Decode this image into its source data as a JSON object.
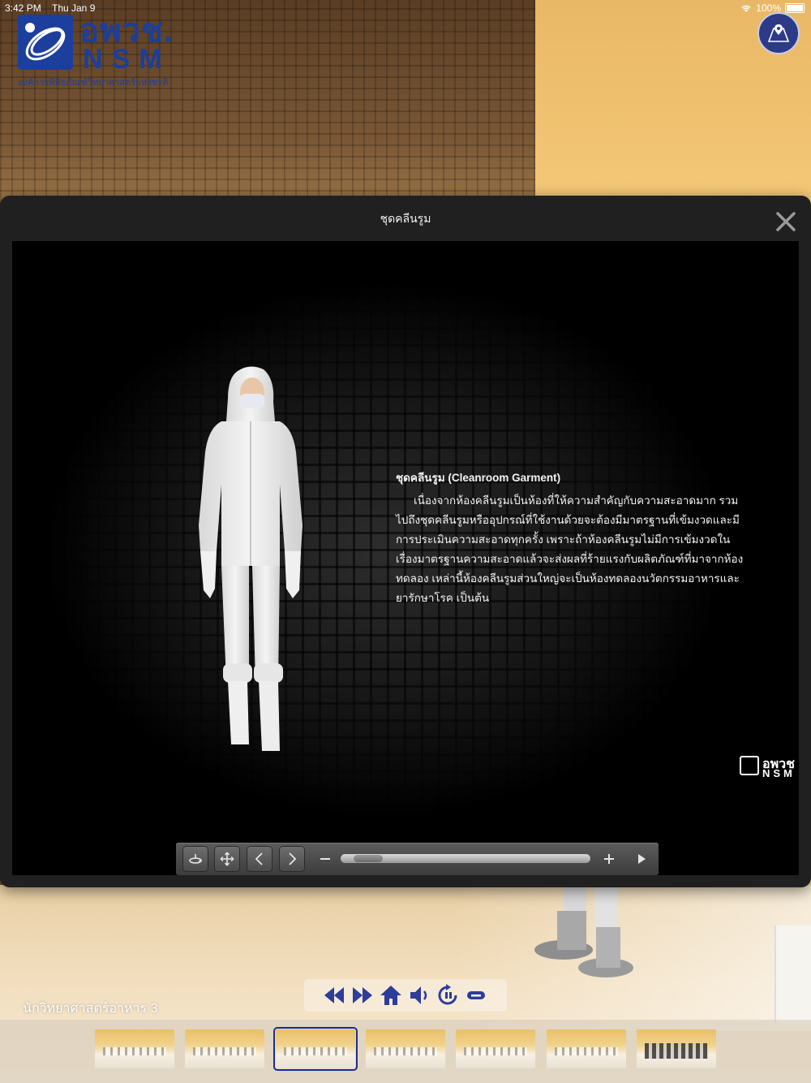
{
  "status_bar": {
    "time": "3:42 PM",
    "date": "Thu Jan 9",
    "battery": "100%"
  },
  "logo": {
    "thai_name": "อพวช.",
    "english_name": "NSM",
    "subtitle": "องค์การพิพิธภัณฑ์วิทยาศาสตร์แห่งชาติ"
  },
  "watermark": {
    "thai_name": "อพวช",
    "english_name": "NSM"
  },
  "modal": {
    "title": "ชุดคลีนรูม",
    "info_heading": "ชุดคลีนรูม (Cleanroom Garment)",
    "info_body": "เนื่องจากห้องคลีนรูมเป็นห้องที่ให้ความสำคัญกับความสะอาดมาก รวมไปถึงชุดคลีนรูมหรืออุปกรณ์ที่ใช้งานด้วยจะต้องมีมาตรฐานที่เข้มงวดและมีการประเมินความสะอาดทุกครั้ง เพราะถ้าห้องคลีนรูมไม่มีการเข้มงวดในเรื่องมาตรฐานความสะอาดแล้วจะส่งผลที่ร้ายแรงกับผลิตภัณฑ์ที่มาจากห้องทดลอง เหล่านี้ห้องคลีนรูมส่วนใหญ่จะเป็นห้องทดลองนวัตกรรมอาหารและยารักษาโรค เป็นต้น"
  },
  "viewer_toolbar": {
    "zoom_level": 0.05,
    "buttons": [
      "rotate-icon",
      "move-icon",
      "chevron-left-icon",
      "chevron-right-icon",
      "minus-icon",
      "plus-icon",
      "play-icon"
    ]
  },
  "tour": {
    "scene_name": "นักวิทยาศาสตร์อาหาร 3",
    "controls": [
      "rewind-icon",
      "fast-forward-icon",
      "home-icon",
      "speaker-icon",
      "autorotate-icon",
      "hide-icon"
    ],
    "thumbnails_count": 7,
    "active_thumbnail": 3
  },
  "colors": {
    "brand_blue": "#1c3e9c",
    "map_button": "#2d3a88",
    "tour_icon": "#2e3c9a",
    "modal_bg": "#202020"
  }
}
